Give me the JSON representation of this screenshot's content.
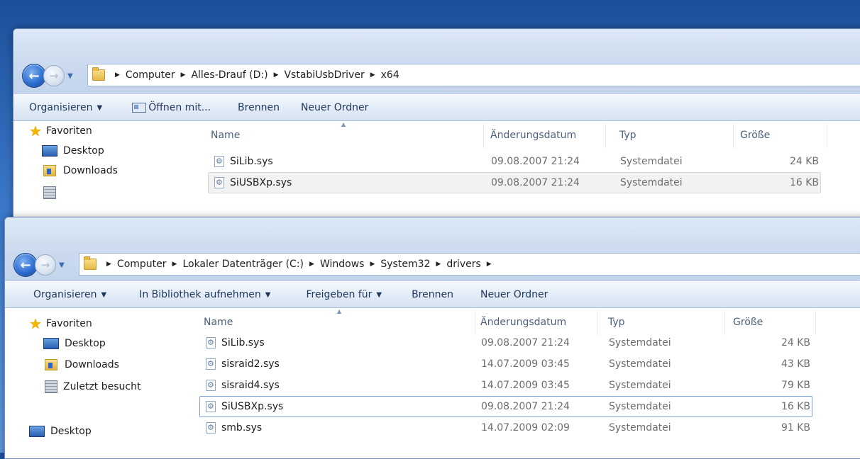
{
  "window1": {
    "breadcrumb": [
      "Computer",
      "Alles-Drauf (D:)",
      "VstabiUsbDriver",
      "x64"
    ],
    "toolbar": {
      "organize": "Organisieren",
      "open_with": "Öffnen mit...",
      "burn": "Brennen",
      "new_folder": "Neuer Ordner"
    },
    "nav": {
      "favorites": "Favoriten",
      "desktop": "Desktop",
      "downloads": "Downloads"
    },
    "columns": {
      "name": "Name",
      "date": "Änderungsdatum",
      "type": "Typ",
      "size": "Größe"
    },
    "files": [
      {
        "name": "SiLib.sys",
        "date": "09.08.2007 21:24",
        "type": "Systemdatei",
        "size": "24 KB"
      },
      {
        "name": "SiUSBXp.sys",
        "date": "09.08.2007 21:24",
        "type": "Systemdatei",
        "size": "16 KB"
      }
    ]
  },
  "window2": {
    "breadcrumb": [
      "Computer",
      "Lokaler Datenträger (C:)",
      "Windows",
      "System32",
      "drivers"
    ],
    "toolbar": {
      "organize": "Organisieren",
      "include_library": "In Bibliothek aufnehmen",
      "share": "Freigeben für",
      "burn": "Brennen",
      "new_folder": "Neuer Ordner"
    },
    "nav": {
      "favorites": "Favoriten",
      "desktop": "Desktop",
      "downloads": "Downloads",
      "recent": "Zuletzt besucht",
      "desktop2": "Desktop"
    },
    "columns": {
      "name": "Name",
      "date": "Änderungsdatum",
      "type": "Typ",
      "size": "Größe"
    },
    "files": [
      {
        "name": "SiLib.sys",
        "date": "09.08.2007 21:24",
        "type": "Systemdatei",
        "size": "24 KB"
      },
      {
        "name": "sisraid2.sys",
        "date": "14.07.2009 03:45",
        "type": "Systemdatei",
        "size": "43 KB"
      },
      {
        "name": "sisraid4.sys",
        "date": "14.07.2009 03:45",
        "type": "Systemdatei",
        "size": "79 KB"
      },
      {
        "name": "SiUSBXp.sys",
        "date": "09.08.2007 21:24",
        "type": "Systemdatei",
        "size": "16 KB"
      },
      {
        "name": "smb.sys",
        "date": "14.07.2009 02:09",
        "type": "Systemdatei",
        "size": "91 KB"
      }
    ]
  },
  "icons": {
    "back": "back-arrow-icon",
    "forward": "forward-arrow-icon",
    "dropdown": "chevron-down-icon",
    "folder": "folder-icon",
    "breadcrumb_sep": "triangle-right-icon",
    "sys_file": "system-file-icon",
    "favorites": "star-icon",
    "desktop": "desktop-icon",
    "downloads": "downloads-icon",
    "recent": "recent-places-icon"
  }
}
